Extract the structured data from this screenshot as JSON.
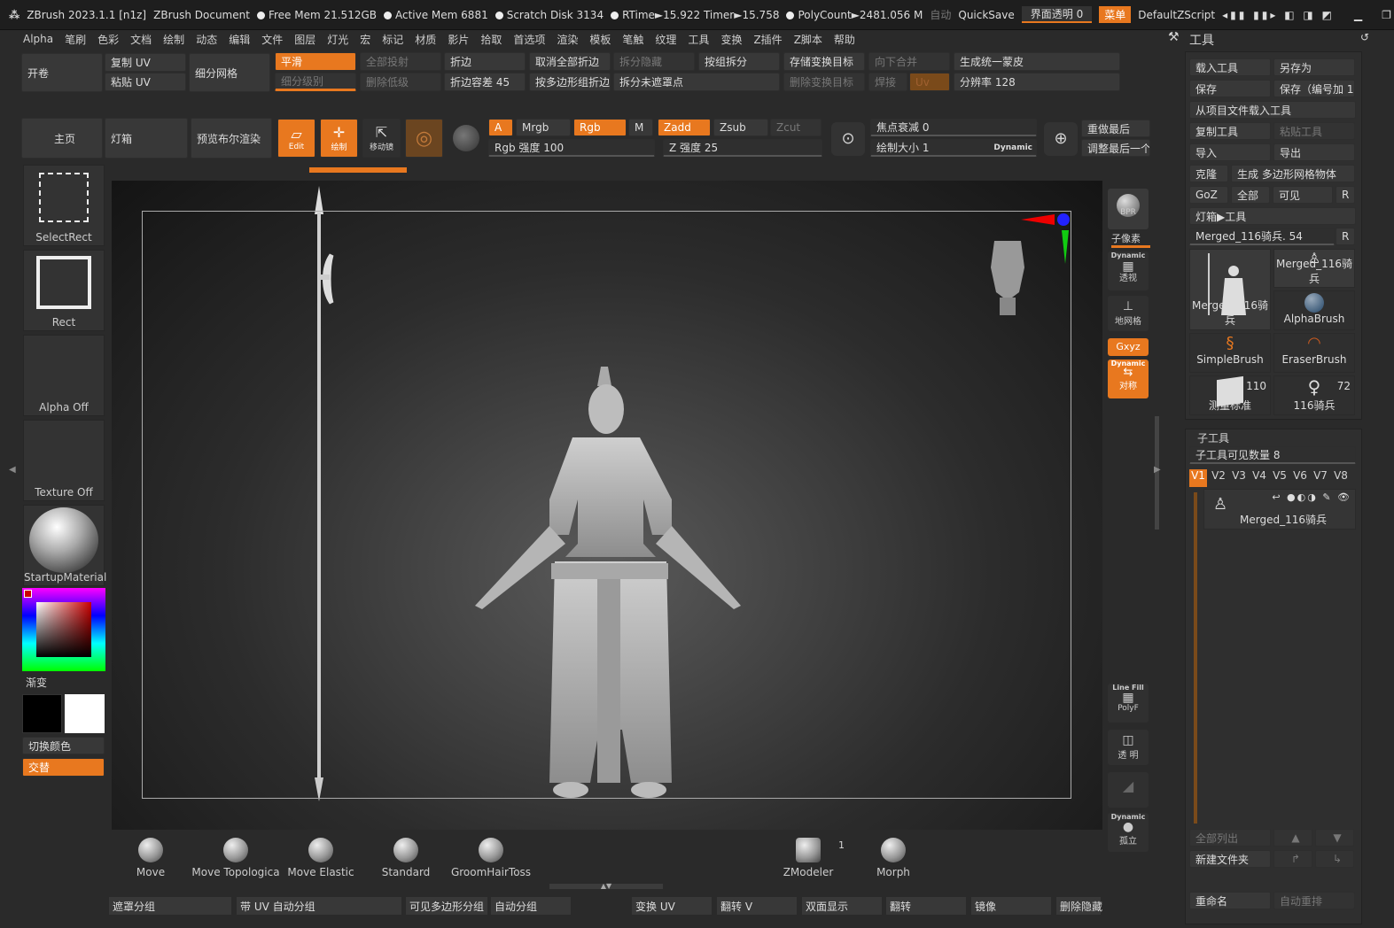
{
  "titlebar": {
    "app": "ZBrush 2023.1.1 [n1z]",
    "doc": "ZBrush Document",
    "free_mem": "Free Mem 21.512GB",
    "active_mem": "Active Mem 6881",
    "scratch": "Scratch Disk 3134",
    "rtime": "RTime►15.922 Timer►15.758",
    "polycount": "PolyCount►2481.056 M",
    "auto": "自动",
    "quicksave": "QuickSave",
    "transparency": "界面透明 0",
    "menu_btn": "菜单",
    "script": "DefaultZScript"
  },
  "menu": [
    "Alpha",
    "笔刷",
    "色彩",
    "文档",
    "绘制",
    "动态",
    "编辑",
    "文件",
    "图层",
    "灯光",
    "宏",
    "标记",
    "材质",
    "影片",
    "拾取",
    "首选项",
    "渲染",
    "模板",
    "笔触",
    "纹理",
    "工具",
    "变换",
    "Z插件",
    "Z脚本",
    "帮助"
  ],
  "toolbar1": {
    "open": "开卷",
    "copy_uv": "复制 UV",
    "paste_uv": "粘贴 UV",
    "subdiv": "细分网格",
    "smooth": "平滑",
    "project_all": "全部投射",
    "subdiv_level": "细分级别",
    "del_lower": "删除低级",
    "crease": "折边",
    "crease_tol": "折边容差 45",
    "uncrease_all": "取消全部折边",
    "crease_by_pg": "按多边形组折边",
    "split_hidden": "拆分隐藏",
    "split_unmasked": "拆分未遮罩点",
    "split_by_group": "按组拆分",
    "store_morph": "存储变换目标",
    "del_morph": "删除变换目标",
    "merge_down": "向下合并",
    "weld": "焊接",
    "uv": "Uv",
    "unify_skin": "生成统一蒙皮",
    "resolution": "分辨率 128"
  },
  "toolbar2": {
    "home": "主页",
    "lightbox": "灯箱",
    "bpr_preview": "预览布尔渲染",
    "edit": "Edit",
    "draw": "绘制",
    "move": "移动镜",
    "a": "A",
    "mrgb": "Mrgb",
    "rgb": "Rgb",
    "m": "M",
    "zadd": "Zadd",
    "zsub": "Zsub",
    "zcut": "Zcut",
    "rgb_intensity": "Rgb 强度 100",
    "z_intensity": "Z 强度 25",
    "focal_shift": "焦点衰减 0",
    "draw_size": "绘制大小 1",
    "dynamic": "Dynamic",
    "redo_last": "重做最后",
    "adjust_last": "调整最后一个"
  },
  "left": {
    "select_rect": "SelectRect",
    "rect": "Rect",
    "alpha_off": "Alpha Off",
    "texture_off": "Texture Off",
    "material": "StartupMaterial",
    "gradient": "渐变",
    "switch_color": "切换颜色",
    "alternate": "交替"
  },
  "right_tools": {
    "bpr": "BPR",
    "subpixel": "子像素",
    "persp": "透视",
    "floor": "地网格",
    "xyz": "Gxyz",
    "sym": "对称",
    "polyf": "PolyF",
    "transp": "透 明",
    "solo": "孤立",
    "linefill": "Line Fill"
  },
  "brushes": [
    "Move",
    "Move Topologica",
    "Move Elastic",
    "Standard",
    "GroomHairToss",
    "ZModeler",
    "Morph"
  ],
  "zmodeler_count": "1",
  "bottom": {
    "mask_group": "遮罩分组",
    "uv_autogroup": "带 UV 自动分组",
    "visible_pg": "可见多边形分组",
    "autogroup": "自动分组",
    "transform_uv": "变换 UV",
    "flip_v": "翻转 V",
    "double": "双面显示",
    "flip": "翻转",
    "mirror": "镜像",
    "del_hidden": "删除隐藏"
  },
  "toolpanel": {
    "title": "工具",
    "load": "载入工具",
    "save_as": "另存为",
    "save": "保存",
    "save_inc": "保存（编号加 1）",
    "load_project": "从项目文件载入工具",
    "copy": "复制工具",
    "paste": "粘贴工具",
    "import": "导入",
    "export": "导出",
    "clone": "克隆",
    "make_polymesh": "生成 多边形网格物体",
    "goz": "GoZ",
    "all": "全部",
    "visible": "可见",
    "r": "R",
    "lightbox_tools": "灯箱▶工具",
    "current": "Merged_116骑兵. 54",
    "thumbs": [
      {
        "name": "Merged_116骑兵"
      },
      {
        "name": "Merged_116骑兵"
      },
      {
        "name": "AlphaBrush"
      },
      {
        "name": "SimpleBrush"
      },
      {
        "name": "EraserBrush"
      },
      {
        "name": "测量标准",
        "count": "110"
      },
      {
        "name": "116骑兵",
        "count": "72"
      }
    ],
    "subtool": "子工具",
    "visible_count": "子工具可见数量 8",
    "versions": [
      "V1",
      "V2",
      "V3",
      "V4",
      "V5",
      "V6",
      "V7",
      "V8"
    ],
    "subtool_item": "Merged_116骑兵",
    "list_all": "全部列出",
    "new_folder": "新建文件夹",
    "rename": "重命名",
    "auto_reorder": "自动重排"
  }
}
